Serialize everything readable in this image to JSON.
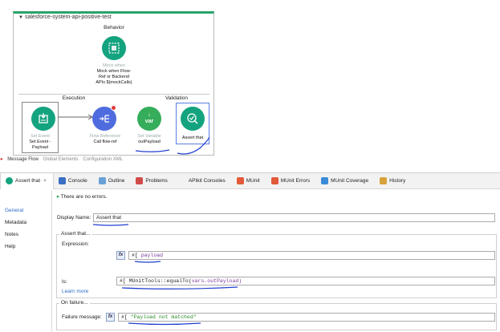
{
  "flow": {
    "title": "salesforce-system-api-positive-test",
    "behavior": {
      "label": "Behavior",
      "mock": {
        "type": "Mock when",
        "name_lines": [
          "Mock when Flow-",
          "Ref or Backend",
          "APIs $(mockCalls)"
        ]
      }
    },
    "execution": {
      "label": "Execution",
      "set_event": {
        "type": "Set Event",
        "name_lines": [
          "Set Event -",
          "Payload"
        ]
      },
      "flow_ref": {
        "type": "Flow Reference",
        "name": "Call flow-ref"
      }
    },
    "validation": {
      "label": "Validation",
      "set_variable": {
        "type": "Set Variable",
        "name": "outPayload",
        "icon_text": "var"
      },
      "assert": {
        "name": "Assert that"
      }
    }
  },
  "editor_tabs": [
    "Message Flow",
    "Global Elements",
    "Configuration XML"
  ],
  "panel_tabs": [
    {
      "label": "Assert that",
      "icon": "assert-icon",
      "active": true
    },
    {
      "label": "Console",
      "icon": "console-icon"
    },
    {
      "label": "Outline",
      "icon": "outline-icon"
    },
    {
      "label": "Problems",
      "icon": "problems-icon"
    },
    {
      "label": "APIkit Consoles",
      "icon": "apikit-icon"
    },
    {
      "label": "MUnit",
      "icon": "munit-icon"
    },
    {
      "label": "MUnit Errors",
      "icon": "munit-errors-icon"
    },
    {
      "label": "MUnit Coverage",
      "icon": "munit-coverage-icon"
    },
    {
      "label": "History",
      "icon": "history-icon"
    }
  ],
  "sidebar": [
    "General",
    "Metadata",
    "Notes",
    "Help"
  ],
  "status": "There are no errors.",
  "form": {
    "display_name_label": "Display Name:",
    "display_name_value": "Assert that",
    "assert_group_label": "Assert that...",
    "expression_label": "Expression:",
    "fx": "fx",
    "expression_prefix": "#[",
    "expression_value": "payload",
    "is_label": "Is:",
    "is_prefix": "#[",
    "is_value_a": "MUnitTools::equalTo(",
    "is_value_b": "vars.outPayload)",
    "learn_more": "Learn more",
    "failure_group_label": "On failure...",
    "failure_label": "Failure message:",
    "failure_prefix": "#[",
    "failure_value": "\"Payload not matched\""
  },
  "colors": {
    "accent": "#2aa36a",
    "teal": "#14a37f",
    "blue": "#4f6cdf",
    "green": "#35ad5b",
    "ink": "#1e3fcf"
  }
}
